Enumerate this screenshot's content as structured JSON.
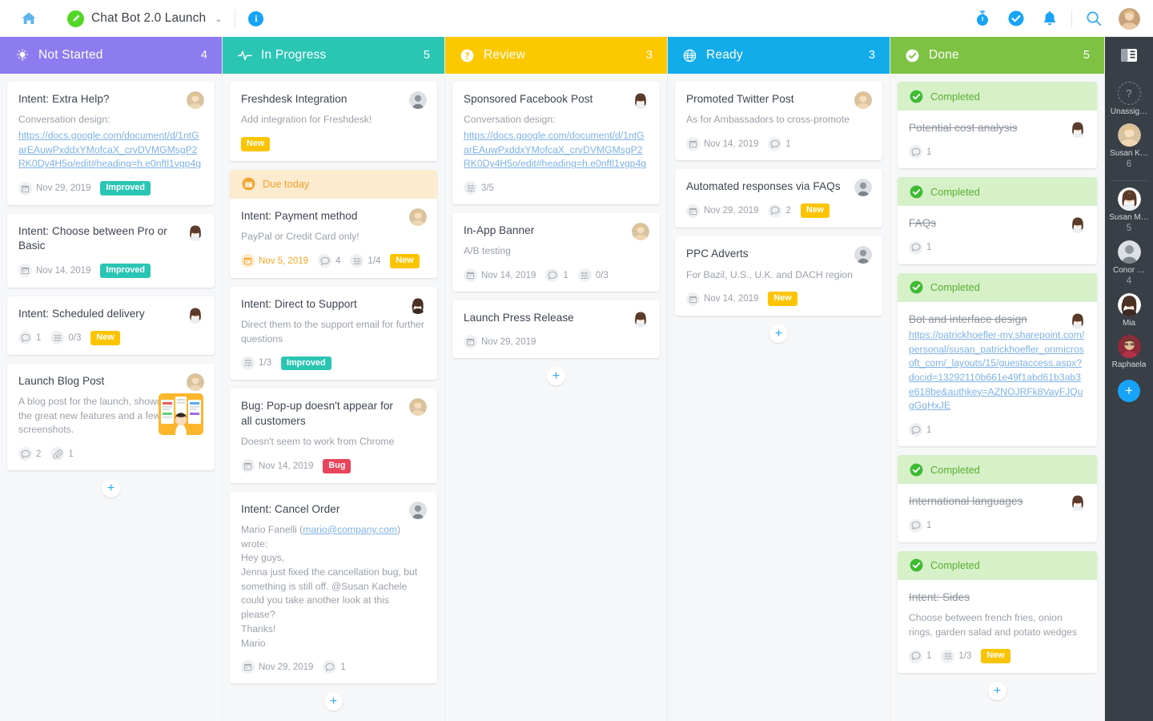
{
  "topbar": {
    "home_icon": "home-icon",
    "project_title": "Chat Bot 2.0 Launch",
    "project_icon": "pen-circle-icon",
    "chevron": "⌄",
    "info_badge": "i",
    "icons": [
      "timer-icon",
      "check-circle-icon",
      "bell-icon",
      "search-icon"
    ]
  },
  "columns": [
    {
      "key": "not_started",
      "title": "Not Started",
      "count": "4",
      "color": "#8d7bf0",
      "icon": "lightbulb-icon",
      "cards": [
        {
          "title": "Intent: Extra Help?",
          "desc": "Conversation design:",
          "link": "https://docs.google.com/document/d/1ntGarEAuwPxddxYMofcaX_crvDVMGMsgP2RK0Dy4H5o/edit#heading=h.e0nftl1vgp4g",
          "avatar": "avatar-susan-k",
          "meta": [
            {
              "icon": "calendar-icon",
              "text": "Nov 29, 2019"
            }
          ],
          "badges": [
            {
              "label": "Improved",
              "type": "improved"
            }
          ]
        },
        {
          "title": "Intent: Choose between Pro or Basic",
          "avatar": "avatar-susan-m",
          "meta": [
            {
              "icon": "calendar-icon",
              "text": "Nov 14, 2019"
            }
          ],
          "badges": [
            {
              "label": "Improved",
              "type": "improved"
            }
          ]
        },
        {
          "title": "Intent: Scheduled delivery",
          "avatar": "avatar-susan-m",
          "meta": [
            {
              "icon": "comment-icon",
              "text": "1"
            },
            {
              "icon": "subtask-icon",
              "text": "0/3"
            }
          ],
          "badges": [
            {
              "label": "New",
              "type": "new"
            }
          ]
        },
        {
          "title": "Launch Blog Post",
          "desc": "A blog post for the launch, showcasing all the great new features and a few screenshots.",
          "avatar": "avatar-susan-k",
          "thumbnail": "blog-post-thumbnail",
          "meta": [
            {
              "icon": "comment-icon",
              "text": "2"
            },
            {
              "icon": "attachment-icon",
              "text": "1"
            }
          ]
        }
      ],
      "add_label": "+"
    },
    {
      "key": "in_progress",
      "title": "In Progress",
      "count": "5",
      "color": "#2bc5b4",
      "icon": "pulse-icon",
      "cards": [
        {
          "title": "Freshdesk Integration",
          "desc": "Add integration for Freshdesk!",
          "avatar": "avatar-conor",
          "badges": [
            {
              "label": "New",
              "type": "new"
            }
          ]
        },
        {
          "banner": {
            "type": "due",
            "label": "Due today",
            "icon": "calendar-icon"
          },
          "title": "Intent: Payment method",
          "desc": "PayPal or Credit Card only!",
          "avatar": "avatar-susan-k",
          "meta": [
            {
              "icon": "calendar-icon",
              "text": "Nov 5, 2019",
              "due": true
            },
            {
              "icon": "comment-icon",
              "text": "4"
            },
            {
              "icon": "subtask-icon",
              "text": "1/4"
            }
          ],
          "badges": [
            {
              "label": "New",
              "type": "new"
            }
          ]
        },
        {
          "title": "Intent: Direct to Support",
          "desc": "Direct them to the support email for further questions",
          "avatar": "avatar-mia",
          "meta": [
            {
              "icon": "subtask-icon",
              "text": "1/3"
            }
          ],
          "badges": [
            {
              "label": "Improved",
              "type": "improved"
            }
          ]
        },
        {
          "title": "Bug: Pop-up doesn't appear for all customers",
          "desc": "Doesn't seem to work from Chrome",
          "avatar": "avatar-susan-k",
          "meta": [
            {
              "icon": "calendar-icon",
              "text": "Nov 14, 2019"
            }
          ],
          "badges": [
            {
              "label": "Bug",
              "type": "bug"
            }
          ]
        },
        {
          "title": "Intent: Cancel Order",
          "desc_prefix": "Mario Fanelli (",
          "desc_link": "mario@company.com",
          "desc_suffix": ") wrote:",
          "desc_body": "\nHey guys,\nJenna just fixed the cancellation bug, but something is still off. @Susan Kachele could you take another look at this please?\nThanks!\nMario",
          "avatar": "avatar-conor",
          "meta": [
            {
              "icon": "calendar-icon",
              "text": "Nov 29, 2019"
            },
            {
              "icon": "comment-icon",
              "text": "1"
            }
          ]
        }
      ],
      "add_label": "+"
    },
    {
      "key": "review",
      "title": "Review",
      "count": "3",
      "color": "#fcc800",
      "icon": "question-circle-icon",
      "cards": [
        {
          "title": "Sponsored Facebook Post",
          "desc": "Conversation design:",
          "link": "https://docs.google.com/document/d/1ntGarEAuwPxddxYMofcaX_crvDVMGMsgP2RK0Dy4H5o/edit#heading=h.e0nftl1vgp4g",
          "avatar": "avatar-susan-m",
          "meta": [
            {
              "icon": "subtask-icon",
              "text": "3/5"
            }
          ]
        },
        {
          "title": "In-App Banner",
          "desc": "A/B testing",
          "avatar": "avatar-susan-k",
          "meta": [
            {
              "icon": "calendar-icon",
              "text": "Nov 14, 2019"
            },
            {
              "icon": "comment-icon",
              "text": "1"
            },
            {
              "icon": "subtask-icon",
              "text": "0/3"
            }
          ]
        },
        {
          "title": "Launch Press Release",
          "avatar": "avatar-susan-m",
          "meta": [
            {
              "icon": "calendar-icon",
              "text": "Nov 29, 2019"
            }
          ]
        }
      ],
      "add_label": "+"
    },
    {
      "key": "ready",
      "title": "Ready",
      "count": "3",
      "color": "#12aceb",
      "icon": "globe-icon",
      "cards": [
        {
          "title": "Promoted Twitter Post",
          "desc": "As for Ambassadors to cross-promote",
          "avatar": "avatar-susan-k",
          "meta": [
            {
              "icon": "calendar-icon",
              "text": "Nov 14, 2019"
            },
            {
              "icon": "comment-icon",
              "text": "1"
            }
          ]
        },
        {
          "title": "Automated responses via FAQs",
          "avatar": "avatar-conor",
          "meta": [
            {
              "icon": "calendar-icon",
              "text": "Nov 29, 2019"
            },
            {
              "icon": "comment-icon",
              "text": "2"
            }
          ],
          "badges": [
            {
              "label": "New",
              "type": "new"
            }
          ]
        },
        {
          "title": "PPC Adverts",
          "desc": "For Bazil, U.S., U.K. and DACH region",
          "avatar": "avatar-conor",
          "meta": [
            {
              "icon": "calendar-icon",
              "text": "Nov 14, 2019"
            }
          ],
          "badges": [
            {
              "label": "New",
              "type": "new"
            }
          ]
        }
      ],
      "add_label": "+"
    },
    {
      "key": "done",
      "title": "Done",
      "count": "5",
      "color": "#7dc243",
      "icon": "check-circle-icon",
      "cards": [
        {
          "banner": {
            "type": "done",
            "label": "Completed",
            "icon": "check-circle-icon"
          },
          "title": "Potential cost analysis",
          "completed": true,
          "avatar": "avatar-susan-m",
          "meta": [
            {
              "icon": "comment-icon",
              "text": "1"
            }
          ]
        },
        {
          "banner": {
            "type": "done",
            "label": "Completed",
            "icon": "check-circle-icon"
          },
          "title": "FAQs",
          "completed": true,
          "avatar": "avatar-susan-m",
          "meta": [
            {
              "icon": "comment-icon",
              "text": "1"
            }
          ]
        },
        {
          "banner": {
            "type": "done",
            "label": "Completed",
            "icon": "check-circle-icon"
          },
          "title": "Bot and interface design",
          "completed": true,
          "link": "https://patrickhoefler-my.sharepoint.com/personal/susan_patrickhoefler_onmicrosoft_com/_layouts/15/guestaccess.aspx?docid=13292110b661e49f1abd61b3ab3e618be&authkey=AZNOJRFk8VayFJQugGqHxJE",
          "avatar": "avatar-susan-m",
          "meta": [
            {
              "icon": "comment-icon",
              "text": "1"
            }
          ]
        },
        {
          "banner": {
            "type": "done",
            "label": "Completed",
            "icon": "check-circle-icon"
          },
          "title": "International languages",
          "completed": true,
          "avatar": "avatar-susan-m",
          "meta": [
            {
              "icon": "comment-icon",
              "text": "1"
            }
          ]
        },
        {
          "banner": {
            "type": "done",
            "label": "Completed",
            "icon": "check-circle-icon"
          },
          "title": "Intent: Sides",
          "completed": true,
          "desc": "Choose between french fries, onion rings, garden salad and potato wedges",
          "meta": [
            {
              "icon": "comment-icon",
              "text": "1"
            },
            {
              "icon": "subtask-icon",
              "text": "1/3"
            }
          ],
          "badges": [
            {
              "label": "New",
              "type": "new"
            }
          ]
        }
      ],
      "add_label": "+"
    }
  ],
  "rail": {
    "panel_icon": "panel-toggle-icon",
    "members": [
      {
        "name": "Unassig…",
        "avatar": "unassigned-icon",
        "count": ""
      },
      {
        "name": "Susan K…",
        "avatar": "avatar-susan-k",
        "count": "6"
      },
      {
        "name": "Susan M…",
        "avatar": "avatar-susan-m",
        "count": "5",
        "after_separator": true
      },
      {
        "name": "Conor …",
        "avatar": "avatar-conor",
        "count": "4"
      },
      {
        "name": "Mia",
        "avatar": "avatar-mia",
        "count": ""
      },
      {
        "name": "Raphaela",
        "avatar": "avatar-raphaela",
        "count": ""
      }
    ],
    "add_label": "+"
  }
}
